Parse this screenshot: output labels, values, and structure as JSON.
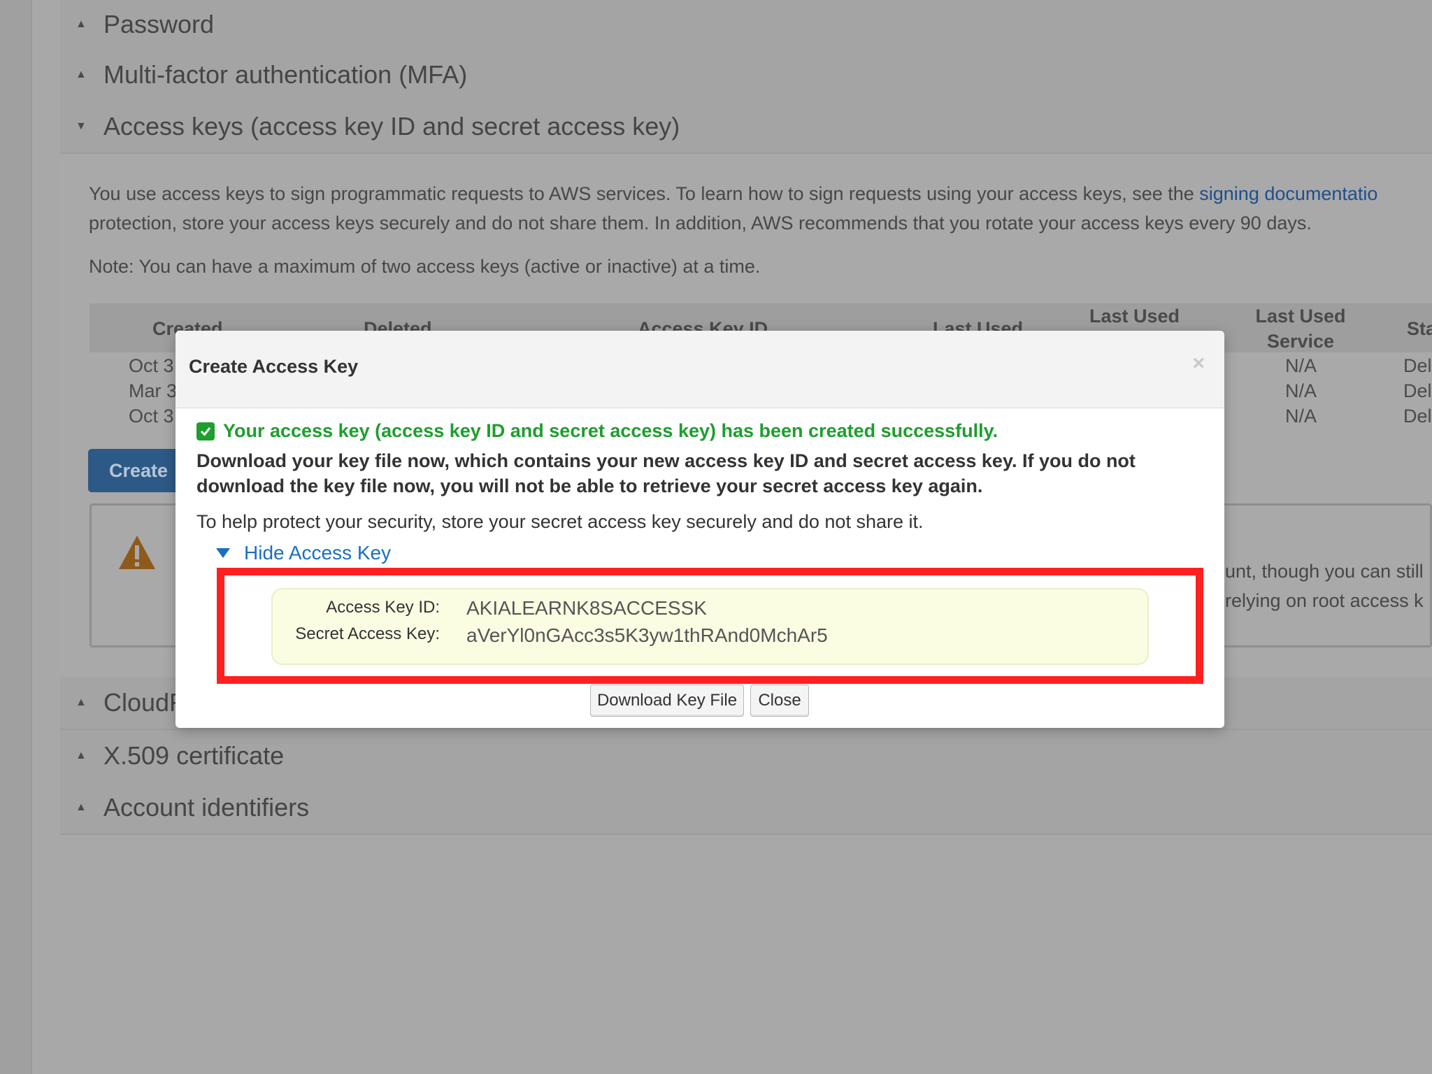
{
  "sections": {
    "password": "Password",
    "mfa": "Multi-factor authentication (MFA)",
    "access_keys": "Access keys (access key ID and secret access key)",
    "cloudfront_partial": "CloudF",
    "x509": "X.509 certificate",
    "account_identifiers": "Account identifiers"
  },
  "access_keys_panel": {
    "description_line1": "You use access keys to sign programmatic requests to AWS services. To learn how to sign requests using your access keys, see the ",
    "description_link": "signing documentatio",
    "description_line2": "protection, store your access keys securely and do not share them. In addition, AWS recommends that you rotate your access keys every 90 days.",
    "note": "Note: You can have a maximum of two access keys (active or inactive) at a time.",
    "table_headers": [
      "Created",
      "Deleted",
      "Access Key ID",
      "Last Used",
      "Last Used",
      "Last Used Service",
      "Sta"
    ],
    "rows": [
      {
        "created": "Oct 3",
        "service": "N/A",
        "status": "Del"
      },
      {
        "created": "Mar 3",
        "service": "N/A",
        "status": "Del"
      },
      {
        "created": "Oct 3",
        "service": "N/A",
        "status": "Del"
      }
    ],
    "create_button": "Create",
    "warning_line1": "unt, though you can still",
    "warning_line2": "relying on root access k"
  },
  "modal": {
    "title": "Create Access Key",
    "close_glyph": "×",
    "success_message": "Your access key (access key ID and secret access key) has been created successfully.",
    "download_warning": "Download your key file now, which contains your new access key ID and secret access key. If you do not download the key file now, you will not be able to retrieve your secret access key again.",
    "security_note": "To help protect your security, store your secret access key securely and do not share it.",
    "toggle_label": "Hide Access Key",
    "access_key_id_label": "Access Key ID:",
    "access_key_id_value": "AKIALEARNK8SACCESSK",
    "secret_key_label": "Secret Access Key:",
    "secret_key_value": "aVerYl0nGAcc3s5K3yw1thRAnd0MchAr5",
    "download_button": "Download Key File",
    "close_button": "Close"
  },
  "colors": {
    "success_green": "#1e9e2e",
    "link_blue": "#1a6fc2",
    "highlight_red": "#ff2020",
    "key_box_bg": "#fbfde3"
  }
}
